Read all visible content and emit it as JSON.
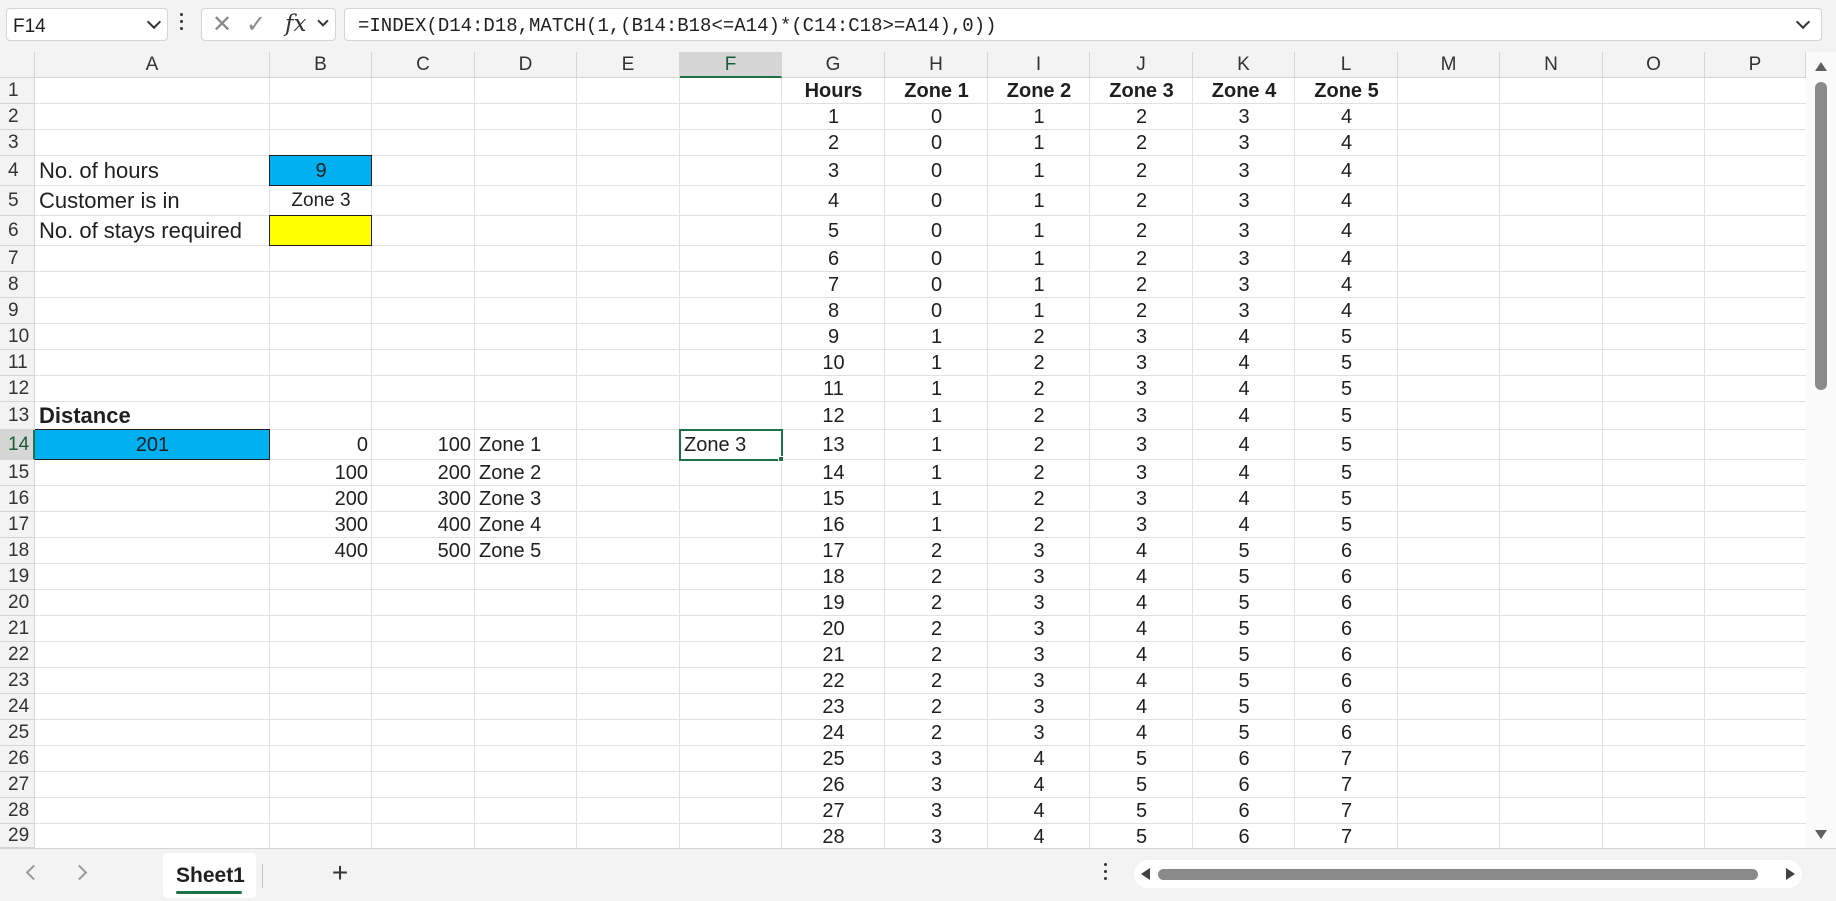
{
  "formula_bar": {
    "name_box": "F14",
    "cancel_icon": "close-icon",
    "enter_icon": "check-icon",
    "fx_label": "fx",
    "formula": "=INDEX(D14:D18,MATCH(1,(B14:B18<=A14)*(C14:C18>=A14),0))"
  },
  "columns": [
    "A",
    "B",
    "C",
    "D",
    "E",
    "F",
    "G",
    "H",
    "I",
    "J",
    "K",
    "L",
    "M",
    "N",
    "O",
    "P"
  ],
  "rows": [
    "1",
    "2",
    "3",
    "4",
    "5",
    "6",
    "7",
    "8",
    "9",
    "10",
    "11",
    "12",
    "13",
    "14",
    "15",
    "16",
    "17",
    "18",
    "19",
    "20",
    "21",
    "22",
    "23",
    "24",
    "25",
    "26",
    "27",
    "28",
    "29"
  ],
  "selected": {
    "column": "F",
    "row": "14"
  },
  "colors": {
    "accent": "#1e7145",
    "cyan_fill": "#00b0f0",
    "yellow_fill": "#ffff00"
  },
  "inputs": {
    "hours_label": "No. of hours",
    "hours_value": "9",
    "zone_label": "Customer is in",
    "zone_value": "Zone 3",
    "stays_label": "No. of stays required",
    "stays_value": ""
  },
  "distance": {
    "title": "Distance",
    "value": "201",
    "result": "Zone 3",
    "table": [
      {
        "from": "0",
        "to": "100",
        "zone": "Zone 1"
      },
      {
        "from": "100",
        "to": "200",
        "zone": "Zone 2"
      },
      {
        "from": "200",
        "to": "300",
        "zone": "Zone 3"
      },
      {
        "from": "300",
        "to": "400",
        "zone": "Zone 4"
      },
      {
        "from": "400",
        "to": "500",
        "zone": "Zone 5"
      }
    ]
  },
  "hours_table": {
    "headers": [
      "Hours",
      "Zone 1",
      "Zone 2",
      "Zone 3",
      "Zone 4",
      "Zone 5"
    ],
    "rows": [
      [
        "1",
        "0",
        "1",
        "2",
        "3",
        "4"
      ],
      [
        "2",
        "0",
        "1",
        "2",
        "3",
        "4"
      ],
      [
        "3",
        "0",
        "1",
        "2",
        "3",
        "4"
      ],
      [
        "4",
        "0",
        "1",
        "2",
        "3",
        "4"
      ],
      [
        "5",
        "0",
        "1",
        "2",
        "3",
        "4"
      ],
      [
        "6",
        "0",
        "1",
        "2",
        "3",
        "4"
      ],
      [
        "7",
        "0",
        "1",
        "2",
        "3",
        "4"
      ],
      [
        "8",
        "0",
        "1",
        "2",
        "3",
        "4"
      ],
      [
        "9",
        "1",
        "2",
        "3",
        "4",
        "5"
      ],
      [
        "10",
        "1",
        "2",
        "3",
        "4",
        "5"
      ],
      [
        "11",
        "1",
        "2",
        "3",
        "4",
        "5"
      ],
      [
        "12",
        "1",
        "2",
        "3",
        "4",
        "5"
      ],
      [
        "13",
        "1",
        "2",
        "3",
        "4",
        "5"
      ],
      [
        "14",
        "1",
        "2",
        "3",
        "4",
        "5"
      ],
      [
        "15",
        "1",
        "2",
        "3",
        "4",
        "5"
      ],
      [
        "16",
        "1",
        "2",
        "3",
        "4",
        "5"
      ],
      [
        "17",
        "2",
        "3",
        "4",
        "5",
        "6"
      ],
      [
        "18",
        "2",
        "3",
        "4",
        "5",
        "6"
      ],
      [
        "19",
        "2",
        "3",
        "4",
        "5",
        "6"
      ],
      [
        "20",
        "2",
        "3",
        "4",
        "5",
        "6"
      ],
      [
        "21",
        "2",
        "3",
        "4",
        "5",
        "6"
      ],
      [
        "22",
        "2",
        "3",
        "4",
        "5",
        "6"
      ],
      [
        "23",
        "2",
        "3",
        "4",
        "5",
        "6"
      ],
      [
        "24",
        "2",
        "3",
        "4",
        "5",
        "6"
      ],
      [
        "25",
        "3",
        "4",
        "5",
        "6",
        "7"
      ],
      [
        "26",
        "3",
        "4",
        "5",
        "6",
        "7"
      ],
      [
        "27",
        "3",
        "4",
        "5",
        "6",
        "7"
      ],
      [
        "28",
        "3",
        "4",
        "5",
        "6",
        "7"
      ]
    ]
  },
  "sheet_tabs": [
    {
      "label": "Sheet1",
      "active": true
    }
  ],
  "add_sheet_label": "+"
}
